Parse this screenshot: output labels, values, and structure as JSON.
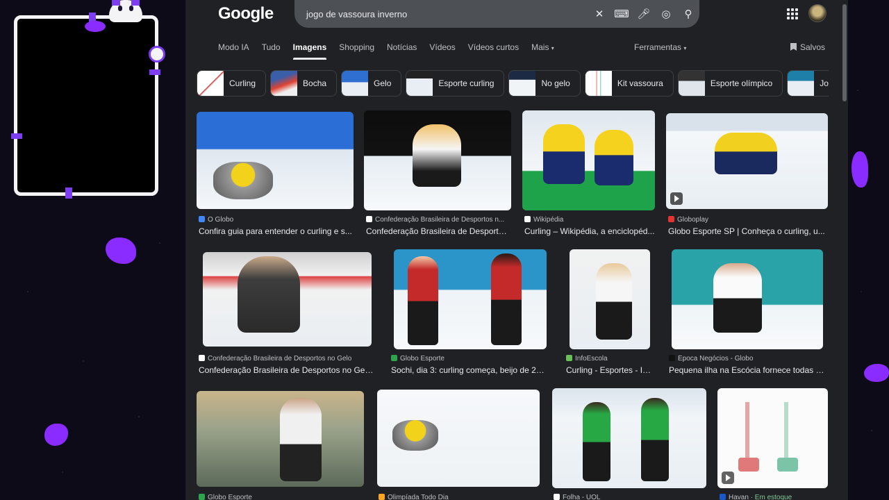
{
  "search": {
    "query": "jogo de vassoura inverno",
    "logo": "Google"
  },
  "tabs": [
    {
      "label": "Modo IA"
    },
    {
      "label": "Tudo"
    },
    {
      "label": "Imagens",
      "active": true
    },
    {
      "label": "Shopping"
    },
    {
      "label": "Notícias"
    },
    {
      "label": "Vídeos"
    },
    {
      "label": "Vídeos curtos"
    },
    {
      "label": "Mais"
    }
  ],
  "tools_label": "Ferramentas",
  "saved_label": "Salvos",
  "chips": [
    {
      "label": "Curling"
    },
    {
      "label": "Bocha"
    },
    {
      "label": "Gelo"
    },
    {
      "label": "Esporte curling"
    },
    {
      "label": "No gelo"
    },
    {
      "label": "Kit vassoura"
    },
    {
      "label": "Esporte olímpico"
    },
    {
      "label": "Jogos ol"
    }
  ],
  "results": [
    {
      "source": "O Globo",
      "caption": "Confira guia para entender o curling e s..."
    },
    {
      "source": "Confederação Brasileira de Desportos n...",
      "caption": "Confederação Brasileira de Desporto..."
    },
    {
      "source": "Wikipédia",
      "caption": "Curling – Wikipédia, a enciclopéd..."
    },
    {
      "source": "Globoplay",
      "caption": "Globo Esporte SP | Conheça o curling, u..."
    },
    {
      "source": "Confederação Brasileira de Desportos no Gelo",
      "caption": "Confederação Brasileira de Desportos no Gelo..."
    },
    {
      "source": "Globo Esporte",
      "caption": "Sochi, dia 3: curling começa, beijo de 201..."
    },
    {
      "source": "InfoEscola",
      "caption": "Curling - Esportes - In..."
    },
    {
      "source": "Época Negócios - Globo",
      "caption": "Pequena ilha na Escócia fornece todas a..."
    },
    {
      "source": "Globo Esporte",
      "caption": ""
    },
    {
      "source": "Olimpíada Todo Dia",
      "caption": ""
    },
    {
      "source": "Folha - UOL",
      "caption": ""
    },
    {
      "source": "Havan",
      "stock": "· Em estoque",
      "caption": ""
    }
  ],
  "colors": {
    "accent_purple": "#8a2cff",
    "background": "#202124"
  }
}
